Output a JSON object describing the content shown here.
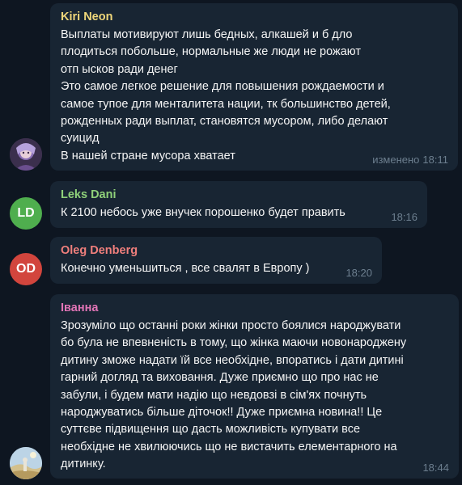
{
  "colors": {
    "background": "#0e1621",
    "bubble": "#182533",
    "kiri_name": "#f0d77a",
    "leks_name": "#8fd17a",
    "leks_avatar": "#4fae4e",
    "oleg_name": "#f07f7c",
    "oleg_avatar": "#d2453d",
    "ivanna_name": "#e275b7",
    "meta": "#6d7f8f"
  },
  "messages": [
    {
      "sender": "Kiri Neon",
      "avatar_icon": "anime-girl-avatar-icon",
      "lines": [
        "Выплаты мотивируют лишь бедных, алкашей и б    дло",
        "плодиться побольше, нормальные же люди не рожают",
        "отп    ысков ради денег",
        "Это самое легкое решение для повышения рождаемости и",
        "самое тупое для менталитета нации, тк большинство детей,",
        "рожденных ради выплат, становятся мусором, либо делают",
        "суицид",
        "В нашей стране мусора хватает"
      ],
      "edited": "изменено",
      "time": "18:11"
    },
    {
      "sender": "Leks Dani",
      "avatar_initials": "LD",
      "lines": [
        "К 2100 небось уже внучек порошенко будет править"
      ],
      "time": "18:16"
    },
    {
      "sender": "Oleg Denberg",
      "avatar_initials": "OD",
      "lines": [
        "Конечно уменьшиться , все свалят в Европу )"
      ],
      "time": "18:20"
    },
    {
      "sender": "Іванна",
      "avatar_icon": "landscape-photo-avatar-icon",
      "lines": [
        "Зрозуміло що останні роки жінки просто боялися народжувати",
        "бо була не впевненість в тому, що жінка маючи новонароджену",
        "дитину зможе надати їй все необхідне, впоратись і дати дитині",
        "гарний догляд та виховання. Дуже приємно що про нас не",
        "забули, і будем мати надію що невдовзі в сім'ях почнуть",
        "народжуватись більше діточок!! Дуже приємна новина!! Це",
        "суттєве підвищення що дасть можливість купувати все",
        "необхідне не хвилюючись що не вистачить елементарного на",
        "дитинку."
      ],
      "time": "18:44"
    }
  ]
}
